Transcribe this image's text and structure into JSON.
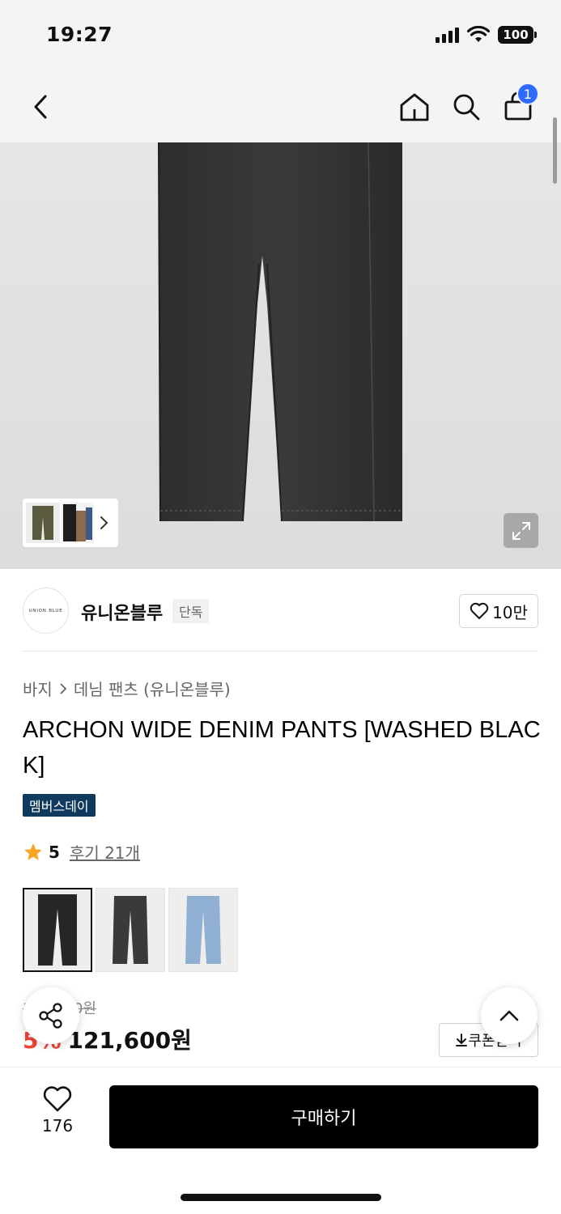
{
  "status_bar": {
    "time": "19:27",
    "battery": "100"
  },
  "nav": {
    "back_icon": "chevron-left-icon",
    "home_icon": "home-icon",
    "search_icon": "search-icon",
    "cart_icon": "shopping-bag-icon",
    "cart_count": "1",
    "badge_color": "#2f6bff"
  },
  "gallery": {
    "thumbnail_chevron": "chevron-right-icon",
    "expand_icon": "expand-icon"
  },
  "brand": {
    "logo_text": "UNION BLUE",
    "name": "유니온블루",
    "tag": "단독",
    "like_count": "10만"
  },
  "breadcrumb": {
    "category": "바지",
    "subcategory": "데님 팬츠 (유니온블루)"
  },
  "product": {
    "title": "ARCHON WIDE DENIM PANTS [WASHED BLACK]",
    "badge": "멤버스데이",
    "badge_color": "#0f3a5e",
    "rating": "5",
    "review_text": "후기 21개",
    "color_options": [
      "washed-black-front",
      "black-wash",
      "light-blue-wash"
    ],
    "selected_color": 0
  },
  "price": {
    "original": "128,000원",
    "discount": "5%",
    "discount_color": "#f04438",
    "sale": "121,600원",
    "coupon_label": "쿠폰받기"
  },
  "bottom": {
    "wish_count": "176",
    "buy_label": "구매하기"
  }
}
